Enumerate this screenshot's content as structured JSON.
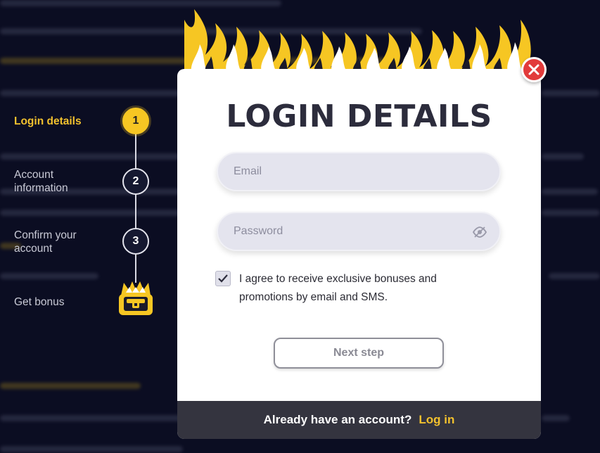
{
  "stepper": {
    "steps": [
      {
        "label": "Login details",
        "number": "1"
      },
      {
        "label": "Account\ninformation",
        "number": "2"
      },
      {
        "label": "Confirm your\naccount",
        "number": "3"
      },
      {
        "label": "Get bonus",
        "icon": "treasure-chest-icon"
      }
    ]
  },
  "modal": {
    "title": "LOGIN DETAILS",
    "email_placeholder": "Email",
    "password_placeholder": "Password",
    "consent_text": "I agree to receive exclusive bonuses and promotions by email and SMS.",
    "consent_checked": true,
    "next_button": "Next step",
    "footer_question": "Already have an account?",
    "footer_link": "Log in"
  },
  "colors": {
    "accent": "#f2c12e",
    "close": "#e23b3b",
    "background": "#0b0d22"
  }
}
